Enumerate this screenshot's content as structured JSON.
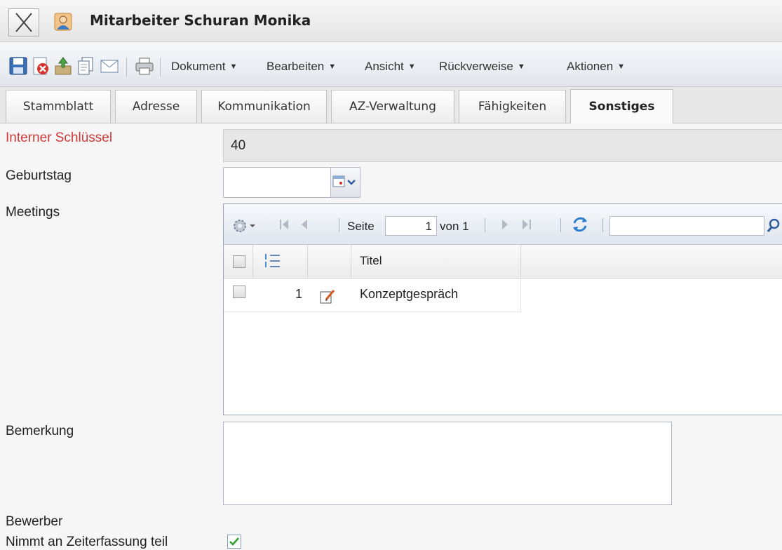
{
  "window": {
    "title": "Mitarbeiter Schuran Monika"
  },
  "toolbar": {
    "icons": [
      "save-icon",
      "delete-icon",
      "export-icon",
      "copy-icon",
      "mail-icon",
      "print-icon"
    ],
    "menus": [
      "Dokument",
      "Bearbeiten",
      "Ansicht",
      "Rückverweise",
      "Aktionen"
    ]
  },
  "tabs": [
    {
      "label": "Stammblatt",
      "active": false
    },
    {
      "label": "Adresse",
      "active": false
    },
    {
      "label": "Kommunikation",
      "active": false
    },
    {
      "label": "AZ-Verwaltung",
      "active": false
    },
    {
      "label": "Fähigkeiten",
      "active": false
    },
    {
      "label": "Sonstiges",
      "active": true
    }
  ],
  "form": {
    "internal_key": {
      "label": "Interner Schlüssel",
      "value": "40"
    },
    "birthday": {
      "label": "Geburtstag",
      "value": ""
    },
    "meetings": {
      "label": "Meetings",
      "pager": {
        "page_label": "Seite",
        "page": "1",
        "of_label": "von 1"
      },
      "search": "",
      "columns": [
        "Titel"
      ],
      "rows": [
        {
          "num": "1",
          "title": "Konzeptgespräch"
        }
      ]
    },
    "remark": {
      "label": "Bemerkung",
      "value": ""
    },
    "applicant": {
      "label": "Bewerber"
    },
    "time_tracking": {
      "label": "Nimmt an Zeiterfassung teil",
      "checked": true
    }
  },
  "colors": {
    "required_label": "#d03a3a",
    "accent": "#2f6fb5"
  }
}
